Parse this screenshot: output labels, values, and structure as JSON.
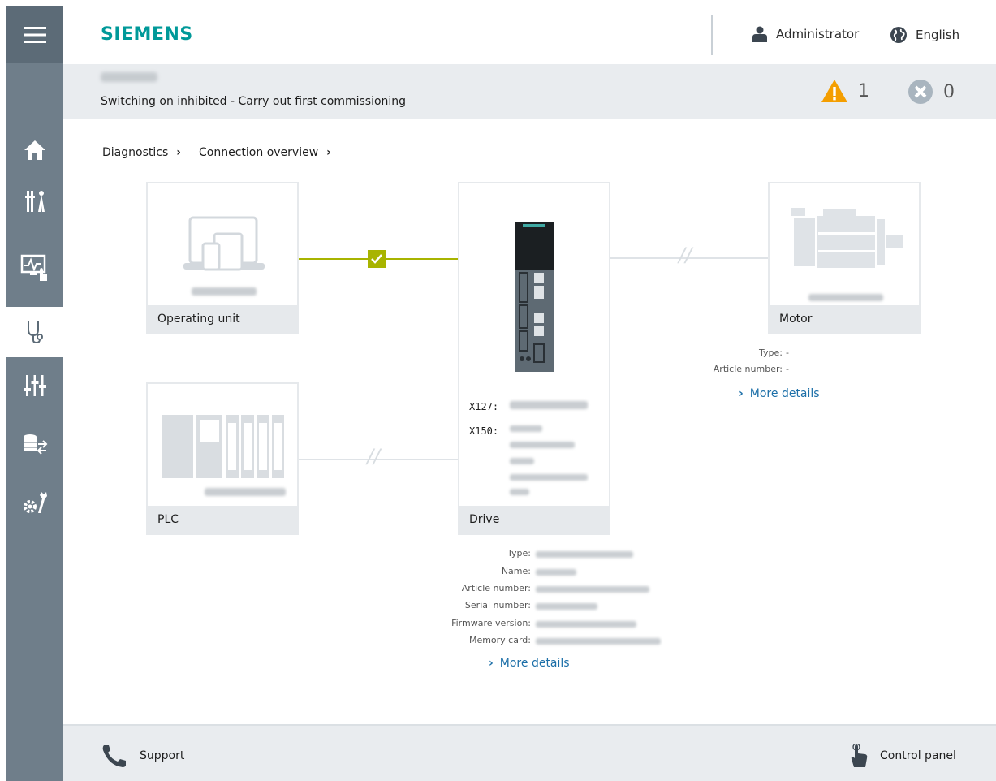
{
  "header": {
    "logo": "SIEMENS",
    "user": "Administrator",
    "language": "English"
  },
  "status": {
    "message": "Switching on inhibited - Carry out first commissioning",
    "warnings": "1",
    "errors": "0"
  },
  "breadcrumb": {
    "items": [
      "Diagnostics",
      "Connection overview"
    ]
  },
  "sidebar": {
    "items": [
      "home-icon",
      "tools-icon",
      "monitor-icon",
      "diagnostics-icon",
      "parameters-icon",
      "backup-icon",
      "settings-icon"
    ]
  },
  "devices": {
    "operating_unit": {
      "label": "Operating unit",
      "connection": "connected"
    },
    "plc": {
      "label": "PLC",
      "connection": "not-connected"
    },
    "drive": {
      "label": "Drive",
      "x127_label": "X127:",
      "x150_label": "X150:"
    },
    "motor": {
      "label": "Motor",
      "connection": "not-connected",
      "type_label": "Type:",
      "type_value": "-",
      "article_label": "Article number:",
      "article_value": "-",
      "more": "More details"
    }
  },
  "drive_details": {
    "labels": [
      "Type:",
      "Name:",
      "Article number:",
      "Serial number:",
      "Firmware version:",
      "Memory card:"
    ],
    "more": "More details"
  },
  "footer": {
    "support": "Support",
    "control_panel": "Control panel"
  },
  "colors": {
    "brand": "#009999",
    "sidebar": "#6f7e8a",
    "connected": "#a8b400",
    "warning": "#f49e00",
    "link": "#1c6fa8"
  }
}
